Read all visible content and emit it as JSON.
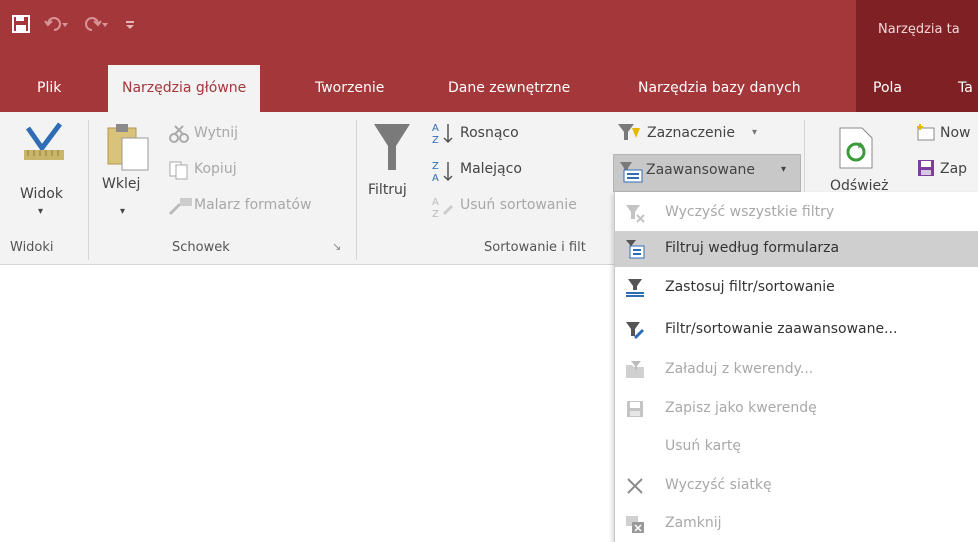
{
  "title_bar": {
    "contextual_title": "Narzędzia ta"
  },
  "tabs": [
    {
      "label": "Plik"
    },
    {
      "label": "Narzędzia główne"
    },
    {
      "label": "Tworzenie"
    },
    {
      "label": "Dane zewnętrzne"
    },
    {
      "label": "Narzędzia bazy danych"
    },
    {
      "label": "Pola"
    },
    {
      "label": "Ta"
    }
  ],
  "ribbon": {
    "widoki": {
      "button": "Widok",
      "group": "Widoki"
    },
    "schowek": {
      "paste": "Wklej",
      "cut": "Wytnij",
      "copy": "Kopiuj",
      "painter": "Malarz formatów",
      "group": "Schowek"
    },
    "sort": {
      "filter": "Filtruj",
      "asc": "Rosnąco",
      "desc": "Malejąco",
      "remove": "Usuń sortowanie",
      "selection": "Zaznaczenie",
      "advanced": "Zaawansowane",
      "group": "Sortowanie i filt"
    },
    "records": {
      "refresh": "Odśwież",
      "new": "Now",
      "save": "Zap"
    }
  },
  "menu": {
    "items": [
      {
        "label": "Wyczyść wszystkie filtry",
        "enabled": false
      },
      {
        "label": "Filtruj według formularza",
        "enabled": true,
        "highlighted": true
      },
      {
        "label": "Zastosuj filtr/sortowanie",
        "enabled": true
      },
      {
        "label": "Filtr/sortowanie zaawansowane...",
        "enabled": true
      },
      {
        "label": "Załaduj z kwerendy...",
        "enabled": false
      },
      {
        "label": "Zapisz jako kwerendę",
        "enabled": false
      },
      {
        "label": "Usuń kartę",
        "enabled": false
      },
      {
        "label": "Wyczyść siatkę",
        "enabled": false
      },
      {
        "label": "Zamknij",
        "enabled": false
      }
    ]
  }
}
